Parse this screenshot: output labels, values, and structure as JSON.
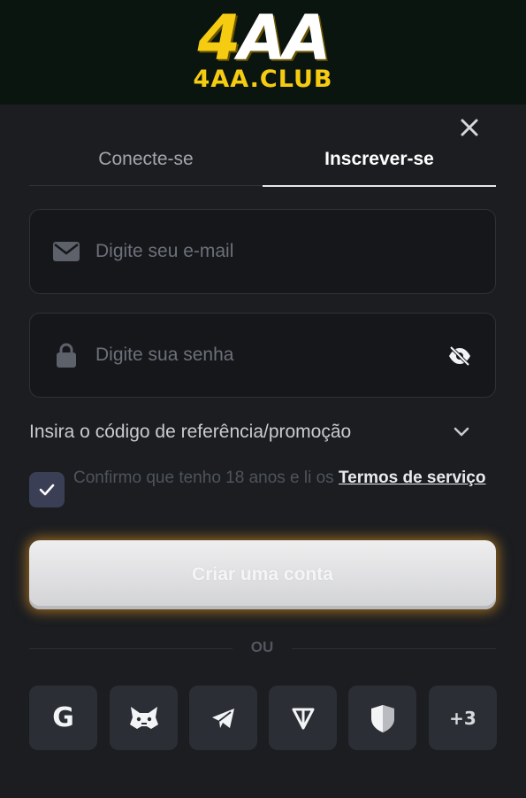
{
  "brand": {
    "logo_main_accent": "4",
    "logo_main_rest": "AA",
    "logo_sub": "4AA.CLUB",
    "accent_color": "#f6cc12"
  },
  "tabs": [
    {
      "label": "Conecte-se",
      "active": false
    },
    {
      "label": "Inscrever-se",
      "active": true
    }
  ],
  "form": {
    "email": {
      "placeholder": "Digite seu e-mail",
      "icon": "mail-icon"
    },
    "password": {
      "placeholder": "Digite sua senha",
      "icon": "lock-icon",
      "toggle_icon": "eye-off-icon"
    },
    "promo_label": "Insira o código de referência/promoção",
    "terms_prefix": "Confirmo que tenho 18 anos e li os ",
    "terms_link": "Termos de serviço",
    "terms_checked": true,
    "submit_label": "Criar uma conta"
  },
  "divider_text": "OU",
  "social": [
    {
      "name": "google",
      "icon": "google-icon",
      "label": "G"
    },
    {
      "name": "metamask",
      "icon": "metamask-icon"
    },
    {
      "name": "telegram",
      "icon": "telegram-icon"
    },
    {
      "name": "ton",
      "icon": "ton-icon"
    },
    {
      "name": "shield",
      "icon": "shield-icon"
    },
    {
      "name": "more",
      "label": "+3"
    }
  ]
}
